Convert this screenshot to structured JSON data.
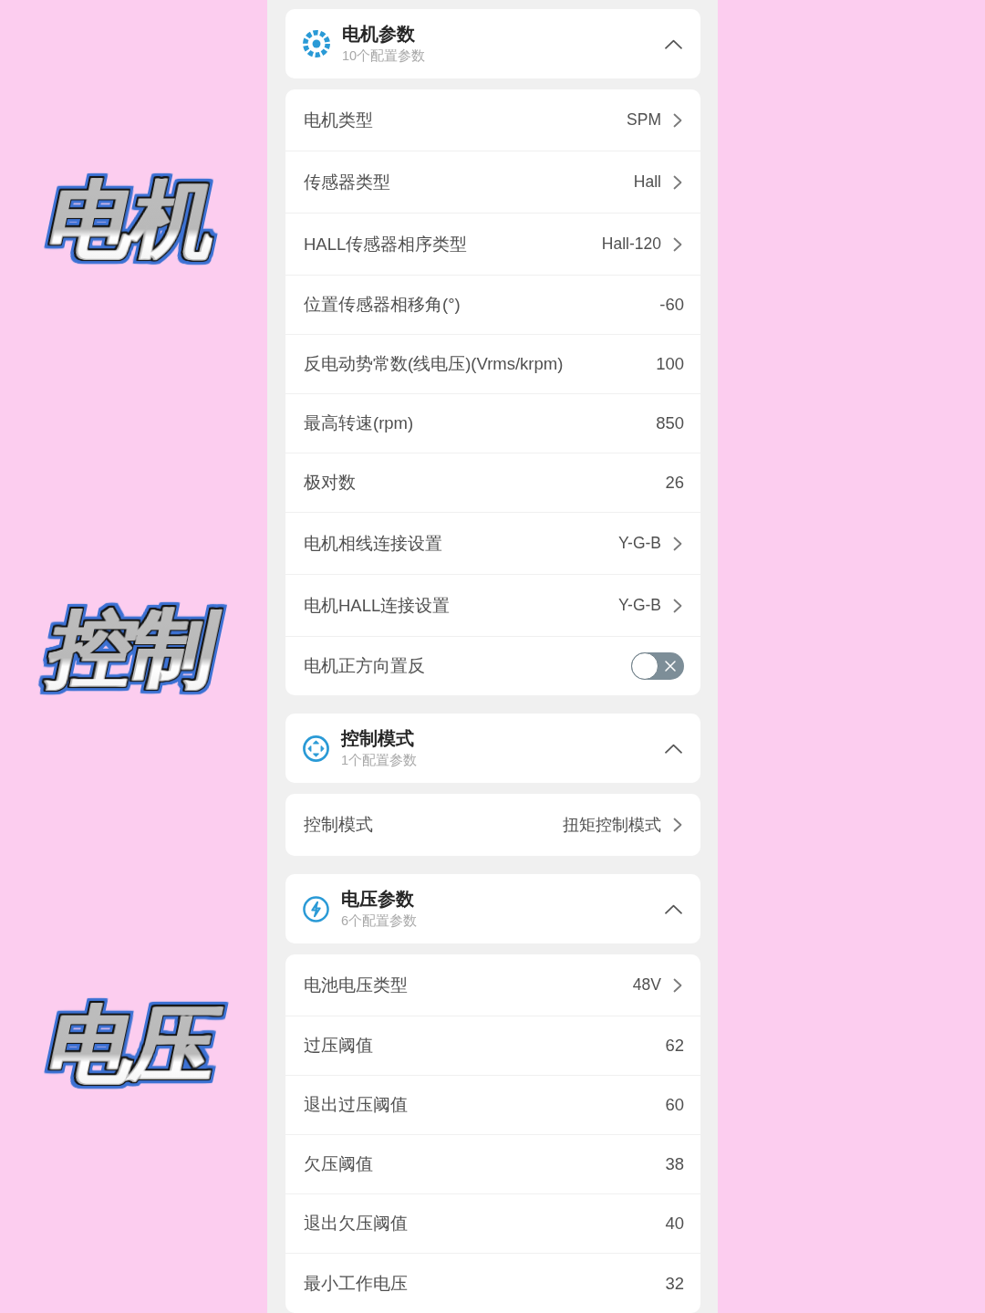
{
  "side_labels": [
    {
      "text": "电机"
    },
    {
      "text": "控制"
    },
    {
      "text": "电压"
    }
  ],
  "sections": [
    {
      "kind": "motor",
      "title": "电机参数",
      "subtitle": "10个配置参数",
      "expanded": true,
      "rows": [
        {
          "kind": "select",
          "label": "电机类型",
          "value": "SPM"
        },
        {
          "kind": "select",
          "label": "传感器类型",
          "value": "Hall"
        },
        {
          "kind": "select",
          "label": "HALL传感器相序类型",
          "value": "Hall-120"
        },
        {
          "kind": "number",
          "label": "位置传感器相移角(°)",
          "value": "-60"
        },
        {
          "kind": "number",
          "label": "反电动势常数(线电压)(Vrms/krpm)",
          "value": "100"
        },
        {
          "kind": "number",
          "label": "最高转速(rpm)",
          "value": "850"
        },
        {
          "kind": "number",
          "label": "极对数",
          "value": "26"
        },
        {
          "kind": "select",
          "label": "电机相线连接设置",
          "value": "Y-G-B"
        },
        {
          "kind": "select",
          "label": "电机HALL连接设置",
          "value": "Y-G-B"
        },
        {
          "kind": "toggle",
          "label": "电机正方向置反",
          "on": false
        }
      ]
    },
    {
      "kind": "mode",
      "title": "控制模式",
      "subtitle": "1个配置参数",
      "expanded": true,
      "rows": [
        {
          "kind": "select",
          "label": "控制模式",
          "value": "扭矩控制模式"
        }
      ]
    },
    {
      "kind": "voltage",
      "title": "电压参数",
      "subtitle": "6个配置参数",
      "expanded": true,
      "rows": [
        {
          "kind": "select",
          "label": "电池电压类型",
          "value": "48V"
        },
        {
          "kind": "number",
          "label": "过压阈值",
          "value": "62"
        },
        {
          "kind": "number",
          "label": "退出过压阈值",
          "value": "60"
        },
        {
          "kind": "number",
          "label": "欠压阈值",
          "value": "38"
        },
        {
          "kind": "number",
          "label": "退出欠压阈值",
          "value": "40"
        },
        {
          "kind": "number",
          "label": "最小工作电压",
          "value": "32"
        }
      ]
    }
  ]
}
